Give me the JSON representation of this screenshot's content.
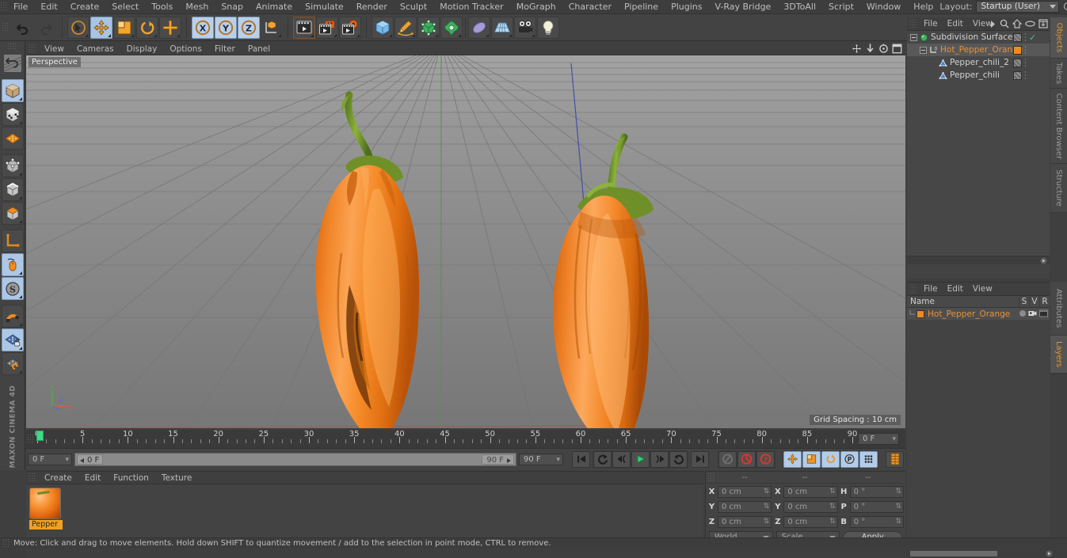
{
  "app": {
    "title": "Cinema 4D",
    "brand_line1": "MAXON",
    "brand_line2": "CINEMA 4D"
  },
  "menubar": {
    "items": [
      "File",
      "Edit",
      "Create",
      "Select",
      "Tools",
      "Mesh",
      "Snap",
      "Animate",
      "Simulate",
      "Render",
      "Sculpt",
      "Motion Tracker",
      "MoGraph",
      "Character",
      "Pipeline",
      "Plugins",
      "V-Ray Bridge",
      "3DToAll",
      "Script",
      "Window",
      "Help"
    ],
    "layout_label": "Layout:",
    "layout_value": "Startup (User)",
    "search_icon": "search-icon"
  },
  "toolbar": {
    "groups": [
      {
        "name": "history",
        "buttons": [
          {
            "icon": "undo-icon",
            "label": "Undo",
            "state": "normal"
          },
          {
            "icon": "redo-icon",
            "label": "Redo",
            "state": "disabled"
          }
        ]
      },
      {
        "name": "tools",
        "buttons": [
          {
            "icon": "live-selection-icon",
            "label": "Live Selection",
            "state": "normal"
          },
          {
            "icon": "move-icon",
            "label": "Move",
            "state": "active"
          },
          {
            "icon": "scale-icon",
            "label": "Scale",
            "state": "normal"
          },
          {
            "icon": "rotate-icon",
            "label": "Rotate",
            "state": "normal"
          },
          {
            "icon": "cursor-plus-icon",
            "label": "Cursor",
            "state": "normal"
          }
        ]
      },
      {
        "name": "axis-locks",
        "buttons": [
          {
            "icon": "lock-x-icon",
            "label": "X",
            "state": "active"
          },
          {
            "icon": "lock-y-icon",
            "label": "Y",
            "state": "active"
          },
          {
            "icon": "lock-z-icon",
            "label": "Z",
            "state": "active"
          },
          {
            "icon": "world-coord-icon",
            "label": "World/Object Coordinate System",
            "state": "normal"
          }
        ]
      },
      {
        "name": "render",
        "buttons": [
          {
            "icon": "render-view-icon",
            "label": "Render View",
            "state": "normal"
          },
          {
            "icon": "render-region-icon",
            "label": "Render to Picture Viewer",
            "state": "normal"
          },
          {
            "icon": "render-settings-icon",
            "label": "Edit Render Settings",
            "state": "normal"
          }
        ]
      },
      {
        "name": "objects",
        "buttons": [
          {
            "icon": "cube-primitive-icon",
            "label": "Add Cube Object",
            "state": "normal"
          },
          {
            "icon": "spline-pen-icon",
            "label": "Add Spline",
            "state": "normal"
          },
          {
            "icon": "generator-icon",
            "label": "Add Generator",
            "state": "normal"
          },
          {
            "icon": "deformer-icon",
            "label": "Add Deformer",
            "state": "normal"
          },
          {
            "icon": "environment-icon",
            "label": "Add Environment",
            "state": "normal"
          },
          {
            "icon": "floor-icon",
            "label": "Add Floor",
            "state": "normal"
          },
          {
            "icon": "camera-icon",
            "label": "Add Camera",
            "state": "normal"
          },
          {
            "icon": "light-icon",
            "label": "Add Light",
            "state": "normal"
          }
        ]
      }
    ]
  },
  "lefttoolbar": {
    "buttons": [
      {
        "icon": "undo-view-icon",
        "label": "Undo View",
        "state": "normal"
      },
      {
        "icon": "model-mode-icon",
        "label": "Model Mode",
        "state": "active"
      },
      {
        "icon": "texture-mode-icon",
        "label": "Texture Mode",
        "state": "normal"
      },
      {
        "icon": "workplane-mode-icon",
        "label": "Workplane Mode",
        "state": "normal"
      },
      {
        "icon": "point-mode-icon",
        "label": "Points Mode",
        "state": "normal"
      },
      {
        "icon": "edge-mode-icon",
        "label": "Edges Mode",
        "state": "normal"
      },
      {
        "icon": "polygon-mode-icon",
        "label": "Polygons Mode",
        "state": "normal"
      },
      {
        "icon": "axis-mode-icon",
        "label": "Enable Axis Modification",
        "state": "normal"
      },
      {
        "icon": "viewport-solo-icon",
        "label": "Viewport Solo",
        "state": "active"
      },
      {
        "icon": "soft-selection-icon",
        "label": "Enable Soft Selection",
        "state": "active"
      },
      {
        "icon": "magnet-icon",
        "label": "Magnet",
        "state": "normal"
      },
      {
        "icon": "workplane-lock-icon",
        "label": "Lock Workplane",
        "state": "active"
      },
      {
        "icon": "workplane-toggle-icon",
        "label": "Toggle Workplane",
        "state": "normal"
      }
    ]
  },
  "viewport": {
    "menu_items": [
      "View",
      "Cameras",
      "Display",
      "Options",
      "Filter",
      "Panel"
    ],
    "label": "Perspective",
    "grid_spacing": "Grid Spacing : 10 cm",
    "corner_icons": [
      "pan-icon",
      "dolly-icon",
      "orbit-icon",
      "maximize-icon"
    ],
    "axis_labels": [
      "Y",
      "X",
      "Z"
    ],
    "scene": "Two orange hot chili peppers with green stems on a grey perspective grid"
  },
  "timeline": {
    "ruler_ticks": [
      0,
      5,
      10,
      15,
      20,
      25,
      30,
      35,
      40,
      45,
      50,
      55,
      60,
      65,
      70,
      75,
      80,
      85,
      90
    ],
    "range_start": 0,
    "range_end": 90,
    "current_frame_field": "0 F",
    "start_field": "0 F",
    "preview_start_field": "0 F",
    "preview_end_field": "90 F",
    "end_field": "90 F",
    "transport": [
      {
        "icon": "go-to-start-icon",
        "label": "Go to Start",
        "state": "normal"
      },
      {
        "icon": "previous-key-icon",
        "label": "Go to Previous Key",
        "state": "normal"
      },
      {
        "icon": "step-back-icon",
        "label": "Go to Previous Frame",
        "state": "normal"
      },
      {
        "icon": "play-icon",
        "label": "Play Forwards",
        "state": "normal"
      },
      {
        "icon": "step-forward-icon",
        "label": "Go to Next Frame",
        "state": "normal"
      },
      {
        "icon": "next-key-icon",
        "label": "Go to Next Key",
        "state": "normal"
      },
      {
        "icon": "go-to-end-icon",
        "label": "Go to End",
        "state": "normal"
      }
    ],
    "record_group": [
      {
        "icon": "autokey-icon",
        "label": "Autokeying",
        "state": "disabled"
      },
      {
        "icon": "record-icon",
        "label": "Record Active Objects",
        "state": "normal"
      },
      {
        "icon": "keyframe-selection-icon",
        "label": "Keyframe Selection",
        "state": "normal"
      }
    ],
    "key_group": [
      {
        "icon": "position-key-icon",
        "label": "Position",
        "state": "active"
      },
      {
        "icon": "scale-key-icon",
        "label": "Scale",
        "state": "active"
      },
      {
        "icon": "rotation-key-icon",
        "label": "Rotation",
        "state": "active"
      },
      {
        "icon": "pla-key-icon",
        "label": "Point Level Animation",
        "state": "active"
      },
      {
        "icon": "param-key-icon",
        "label": "Parameter",
        "state": "active"
      },
      {
        "icon": "dope-sheet-icon",
        "label": "Dope Sheet",
        "state": "normal"
      }
    ]
  },
  "materials": {
    "menu_items": [
      "Create",
      "Edit",
      "Function",
      "Texture"
    ],
    "items": [
      {
        "name": "Pepper",
        "selected": true,
        "preview": "orange-pepper-sphere"
      }
    ]
  },
  "coordinates": {
    "headers": [
      "--",
      "--",
      "--"
    ],
    "rows": [
      {
        "axis_pos": "X",
        "position": "0 cm",
        "axis_size": "X",
        "size": "0 cm",
        "axis_rot": "H",
        "rotation": "0 °"
      },
      {
        "axis_pos": "Y",
        "position": "0 cm",
        "axis_size": "Y",
        "size": "0 cm",
        "axis_rot": "P",
        "rotation": "0 °"
      },
      {
        "axis_pos": "Z",
        "position": "0 cm",
        "axis_size": "Z",
        "size": "0 cm",
        "axis_rot": "B",
        "rotation": "0 °"
      }
    ],
    "system": "World",
    "mode": "Scale",
    "apply": "Apply"
  },
  "object_manager": {
    "menu_items": [
      "File",
      "Edit",
      "View"
    ],
    "header_icons": [
      "more-arrow-icon",
      "search-icon",
      "home-icon",
      "ellipse-icon",
      "fit-icon"
    ],
    "rows": [
      {
        "name": "Subdivision Surface",
        "indent": 0,
        "icon": "subdivision-surface-icon",
        "selected": false,
        "check": true,
        "tags": [
          "hatch"
        ],
        "material": false
      },
      {
        "name": "Hot_Pepper_Orange",
        "indent": 1,
        "icon": "layer-zero-icon",
        "selected": true,
        "check": false,
        "tags": [
          "orange"
        ],
        "material": false
      },
      {
        "name": "Pepper_chili_2",
        "indent": 2,
        "icon": "polygon-object-icon",
        "selected": false,
        "check": false,
        "tags": [
          "hatch"
        ],
        "material": true
      },
      {
        "name": "Pepper_chili",
        "indent": 2,
        "icon": "polygon-object-icon",
        "selected": false,
        "check": false,
        "tags": [
          "hatch"
        ],
        "material": true
      }
    ]
  },
  "layer_manager": {
    "menu_items": [
      "File",
      "Edit",
      "View"
    ],
    "columns": [
      "Name",
      "S",
      "V",
      "R"
    ],
    "rows": [
      {
        "name": "Hot_Pepper_Orange",
        "swatch": "#ef8b23",
        "solo": "dot",
        "view": "camera-icon",
        "render": "render-icon"
      }
    ]
  },
  "right_tabs_top": [
    {
      "label": "Objects",
      "active": true
    },
    {
      "label": "Takes",
      "active": false
    },
    {
      "label": "Content Browser",
      "active": false
    },
    {
      "label": "Structure",
      "active": false
    }
  ],
  "right_tabs_bottom": [
    {
      "label": "Attributes",
      "active": false
    },
    {
      "label": "Layers",
      "active": true
    }
  ],
  "statusbar": {
    "text": "Move: Click and drag to move elements. Hold down SHIFT to quantize movement / add to the selection in point mode, CTRL to remove."
  },
  "colors": {
    "accent_orange": "#ef8b23",
    "active_blue": "#adc7e6",
    "panel_bg": "#434343",
    "viewport_grey": "#8e8e8e",
    "green_playhead": "#3ddc84"
  }
}
